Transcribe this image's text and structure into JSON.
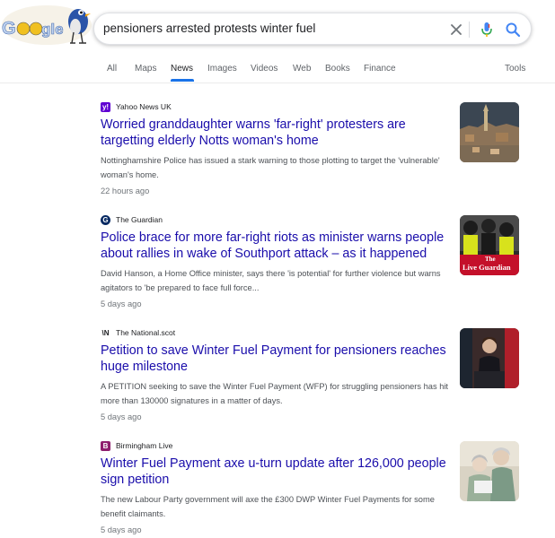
{
  "search": {
    "query": "pensioners arrested protests winter fuel"
  },
  "tabs": [
    "All",
    "Maps",
    "News",
    "Images",
    "Videos",
    "Web",
    "Books",
    "Finance",
    "Tools"
  ],
  "active_tab": "News",
  "results": [
    {
      "source": "Yahoo News UK",
      "favicon_letter": "y!",
      "favicon_color": "#6001d2",
      "title": "Worried granddaughter warns 'far-right' protesters are targetting elderly Notts woman's home",
      "snippet": "Nottinghamshire Police has issued a stark warning to those plotting to target the 'vulnerable' woman's home.",
      "time": "22 hours ago",
      "thumbnail_icon": "town-photo-icon"
    },
    {
      "source": "The Guardian",
      "favicon_letter": "G",
      "favicon_color": "#052962",
      "title": "Police brace for more far-right riots as minister warns people about rallies in wake of Southport attack – as it happened",
      "snippet": "David Hanson, a Home Office minister, says there 'is potential' for further violence but warns agitators to 'be prepared to face full force...",
      "time": "5 days ago",
      "thumbnail_icon": "riot-police-photo-icon",
      "thumbnail_overlay": [
        "The",
        "Live Guardian"
      ]
    },
    {
      "source": "The National.scot",
      "favicon_letter": "\\N",
      "favicon_color": "#ffffff",
      "title": "Petition to save Winter Fuel Payment for pensioners reaches huge milestone",
      "snippet": "A PETITION seeking to save the Winter Fuel Payment (WFP) for struggling pensioners has hit more than 130000 signatures in a matter of days.",
      "time": "5 days ago",
      "thumbnail_icon": "politician-podium-photo-icon"
    },
    {
      "source": "Birmingham Live",
      "favicon_letter": "B",
      "favicon_color": "#8e1e6d",
      "title": "Winter Fuel Payment axe u-turn update after 126,000 people sign petition",
      "snippet": "The new Labour Party government will axe the £300 DWP Winter Fuel Payments for some benefit claimants.",
      "time": "5 days ago",
      "thumbnail_icon": "elderly-couple-photo-icon"
    }
  ],
  "colors": {
    "link": "#1a0dab",
    "tab_active": "#1a73e8",
    "snippet": "#4d5156"
  },
  "icons": {
    "clear": "close-icon",
    "voice": "microphone-icon",
    "search": "search-icon",
    "logo": "google-doodle-logo"
  }
}
